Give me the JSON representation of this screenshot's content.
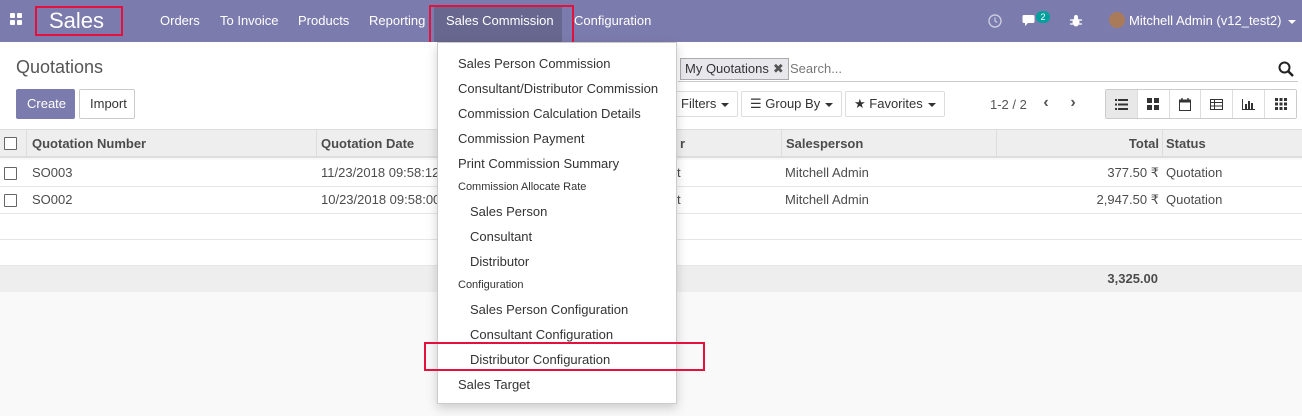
{
  "app": {
    "brand": "Sales"
  },
  "topmenu": {
    "items": [
      "Orders",
      "To Invoice",
      "Products",
      "Reporting",
      "Sales Commission",
      "Configuration"
    ],
    "active": "Sales Commission"
  },
  "systray": {
    "messages_count": "2",
    "user": "Mitchell Admin (v12_test2)"
  },
  "controlpanel": {
    "title": "Quotations",
    "create_label": "Create",
    "import_label": "Import",
    "search": {
      "facet": "My Quotations",
      "placeholder": "Search..."
    },
    "filters_label": "Filters",
    "groupby_label": "Group By",
    "favorites_label": "Favorites",
    "pager": "1-2 / 2",
    "views": [
      "list-icon",
      "kanban-icon",
      "calendar-icon",
      "pivot-icon",
      "graph-icon",
      "grid-icon"
    ]
  },
  "table": {
    "columns": [
      "Quotation Number",
      "Quotation Date",
      "Customer",
      "Salesperson",
      "Total",
      "Status"
    ],
    "rows": [
      {
        "number": "SO003",
        "date": "11/23/2018 09:58:12",
        "customer": "t",
        "salesperson": "Mitchell Admin",
        "total": "377.50 ₹",
        "status": "Quotation"
      },
      {
        "number": "SO002",
        "date": "10/23/2018 09:58:00",
        "customer": "t",
        "salesperson": "Mitchell Admin",
        "total": "2,947.50 ₹",
        "status": "Quotation"
      }
    ],
    "footer_total": "3,325.00"
  },
  "dropdown": {
    "items": [
      "Sales Person Commission",
      "Consultant/Distributor Commission",
      "Commission Calculation Details",
      "Commission Payment",
      "Print Commission Summary"
    ],
    "header1": "Commission Allocate Rate",
    "sub1": [
      "Sales Person",
      "Consultant",
      "Distributor"
    ],
    "header2": "Configuration",
    "sub2": [
      "Sales Person Configuration",
      "Consultant Configuration",
      "Distributor Configuration"
    ],
    "last": "Sales Target"
  },
  "colors": {
    "navbar": "#7c7bad",
    "highlight": "#e4113f",
    "badge": "#00a09d"
  }
}
